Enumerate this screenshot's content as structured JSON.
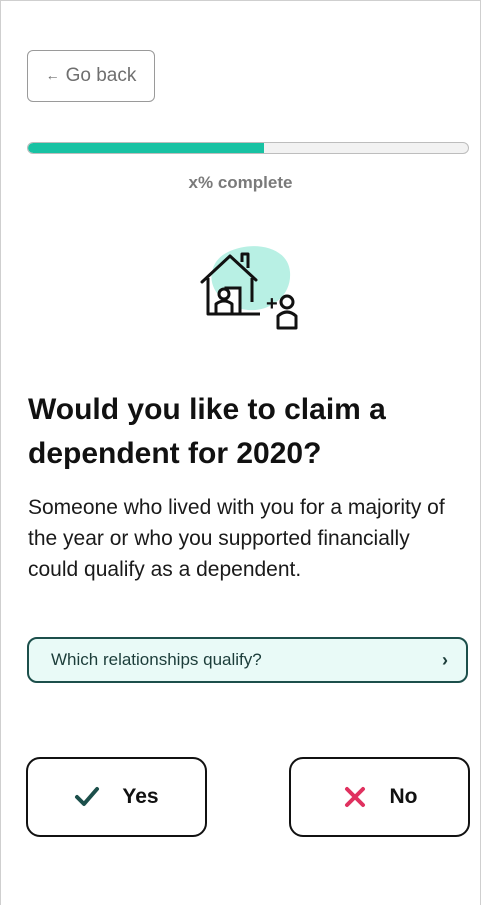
{
  "nav": {
    "back_label": "Go back",
    "back_icon": "left-arrow-icon"
  },
  "progress": {
    "fraction": 0.537,
    "label": "x% complete",
    "fill_color": "#18c2a3"
  },
  "illustration": {
    "icon": "house-plus-dependent-icon",
    "plus_text": "+",
    "accent_color": "#b8f0e4"
  },
  "question": {
    "title": "Would you like to claim a dependent for 2020?",
    "description": "Someone who lived with you for a majority of the year or who you supported financially could qualify as a dependent."
  },
  "help_link": {
    "label": "Which relationships qualify?",
    "chevron": "›"
  },
  "answers": {
    "yes_label": "Yes",
    "yes_icon": "checkmark-icon",
    "yes_icon_color": "#1c4f4b",
    "no_label": "No",
    "no_icon": "x-mark-icon",
    "no_icon_color": "#e0315f"
  }
}
